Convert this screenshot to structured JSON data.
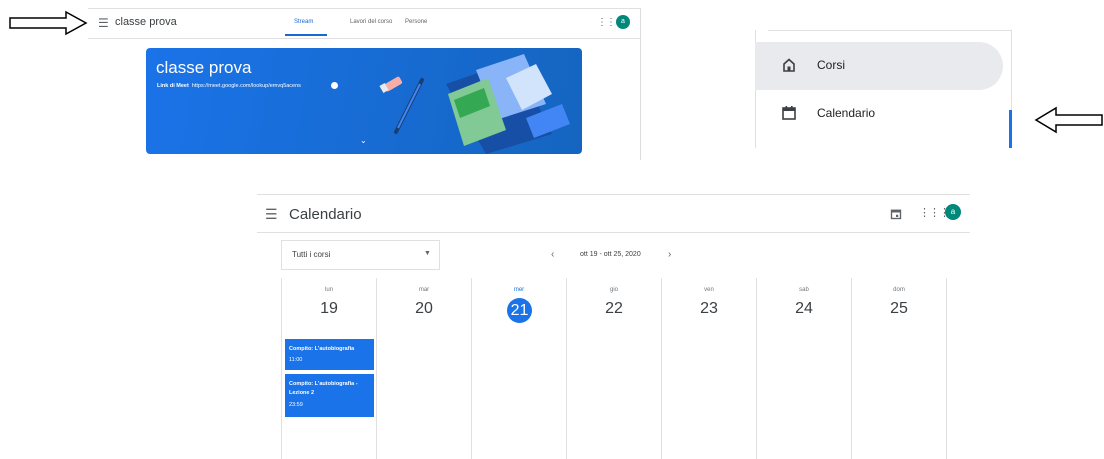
{
  "classroom": {
    "menu_icon": "menu-icon",
    "title": "classe prova",
    "tabs": [
      {
        "label": "Stream",
        "active": true
      },
      {
        "label": "Lavori del corso",
        "active": false
      },
      {
        "label": "Persone",
        "active": false
      }
    ],
    "avatar": "a",
    "banner": {
      "title": "classe prova",
      "meet_label": "Link di Meet",
      "meet_url": "https://meet.google.com/lookup/emvq5acens"
    }
  },
  "nav": {
    "items": [
      {
        "label": "Corsi",
        "icon": "home-icon",
        "active": true
      },
      {
        "label": "Calendario",
        "icon": "calendar-icon",
        "active": false
      }
    ]
  },
  "calendar": {
    "title": "Calendario",
    "avatar": "a",
    "filter": {
      "value": "Tutti i corsi"
    },
    "range": "ott 19 - ott 25, 2020",
    "days": [
      {
        "name": "lun",
        "num": "19"
      },
      {
        "name": "mar",
        "num": "20"
      },
      {
        "name": "mer",
        "num": "21",
        "today": true
      },
      {
        "name": "gio",
        "num": "22"
      },
      {
        "name": "ven",
        "num": "23"
      },
      {
        "name": "sab",
        "num": "24"
      },
      {
        "name": "dom",
        "num": "25"
      }
    ],
    "events": [
      {
        "title": "Compito: L'autobiografia",
        "time": "11:00"
      },
      {
        "title": "Compito: L'autobiografia - Lezione 2",
        "time": "23:59"
      }
    ]
  },
  "colors": {
    "accent": "#1a73e8",
    "avatar": "#00897b"
  }
}
